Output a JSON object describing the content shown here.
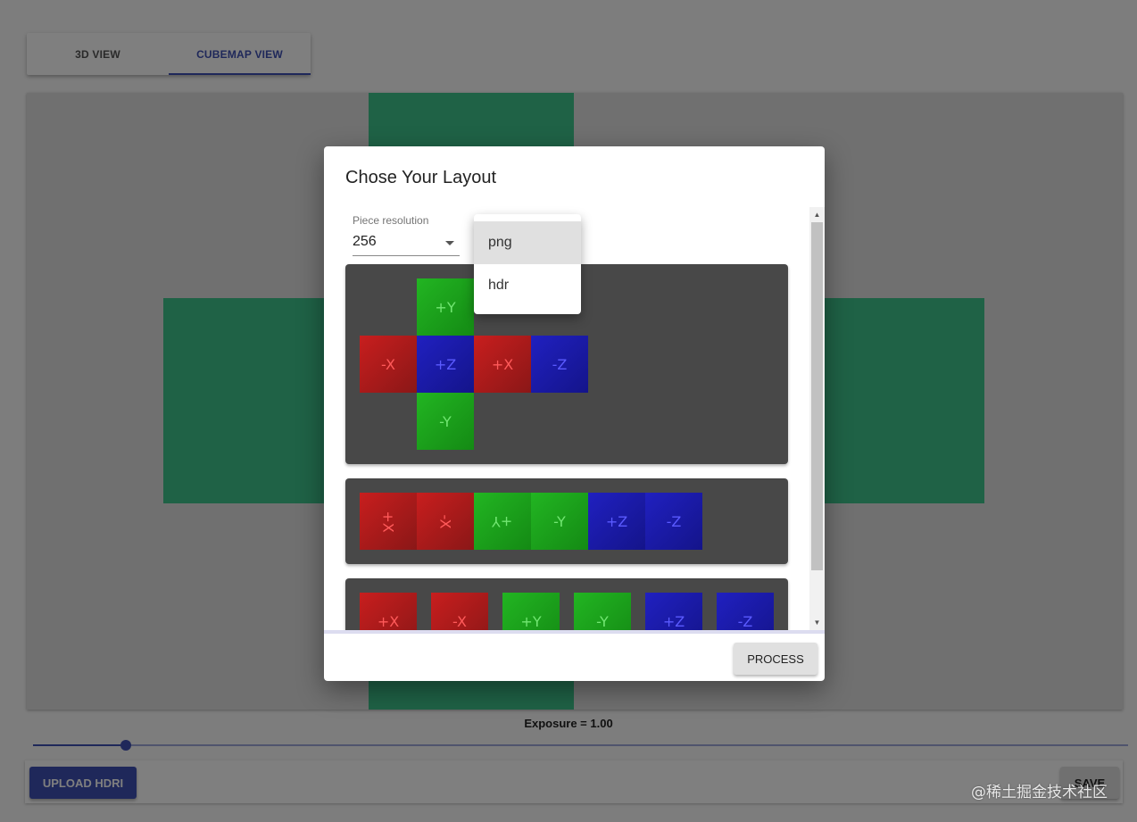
{
  "tabs": [
    {
      "label": "3D VIEW",
      "active": false
    },
    {
      "label": "CUBEMAP VIEW",
      "active": true
    }
  ],
  "exposure": {
    "label": "Exposure = 1.00",
    "slider_fraction": 0.085
  },
  "buttons": {
    "upload": "UPLOAD HDRI",
    "save": "SAVE"
  },
  "watermark": "@稀土掘金技术社区",
  "dialog": {
    "title": "Chose Your Layout",
    "piece_resolution": {
      "label": "Piece resolution",
      "value": "256"
    },
    "process_label": "PROCESS",
    "layouts": [
      {
        "name": "cross",
        "tiles": [
          "+Y",
          "-X",
          "+Z",
          "+X",
          "-Z",
          "-Y"
        ]
      },
      {
        "name": "horizontal-strip",
        "tiles": [
          "+X",
          "-X",
          "+Y",
          "-Y",
          "+Z",
          "-Z"
        ]
      },
      {
        "name": "separate",
        "tiles": [
          "+X",
          "-X",
          "+Y",
          "-Y",
          "+Z",
          "-Z"
        ]
      }
    ]
  },
  "format_menu": {
    "options": [
      "png",
      "hdr"
    ],
    "selected": "png"
  },
  "colors": {
    "accent": "#3f51b5",
    "viewer_face": "#3ec48c",
    "tile_red": "#c81e1e",
    "tile_green": "#22b522",
    "tile_blue": "#2020c0"
  }
}
